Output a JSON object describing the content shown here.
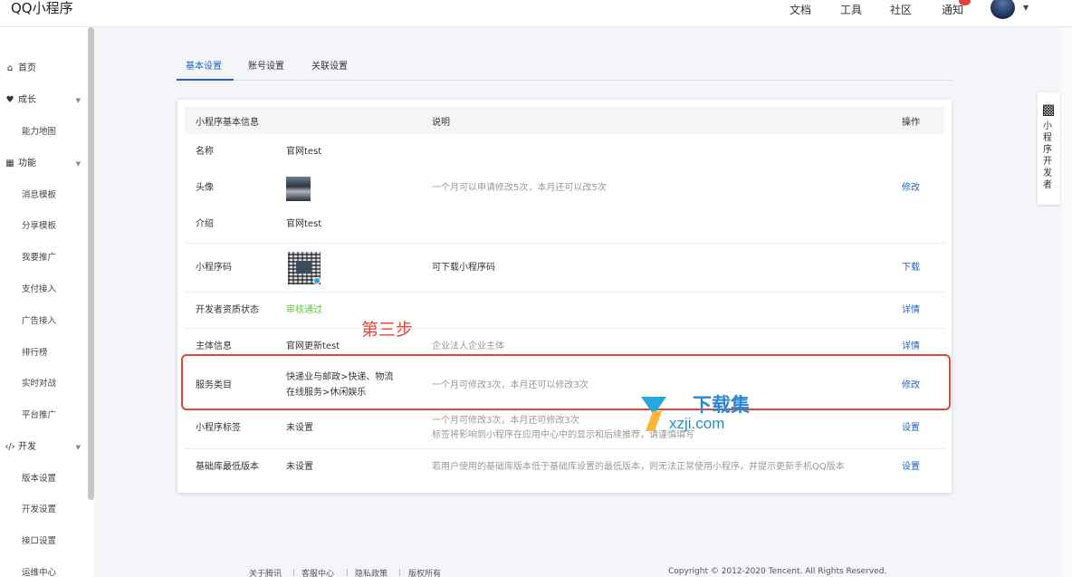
{
  "app": {
    "title": "QQ小程序"
  },
  "topnav": [
    "文档",
    "工具",
    "社区",
    "通知"
  ],
  "sidebar": {
    "items": [
      {
        "label": "首页",
        "icon": "home-icon",
        "glyph": "⌂",
        "type": "group"
      },
      {
        "label": "成长",
        "icon": "growth-icon",
        "glyph": "♥",
        "type": "group",
        "expandable": true
      },
      {
        "label": "能力地图",
        "type": "sub"
      },
      {
        "label": "功能",
        "icon": "function-icon",
        "glyph": "▦",
        "type": "group",
        "expandable": true
      },
      {
        "label": "消息模板",
        "type": "sub"
      },
      {
        "label": "分享模板",
        "type": "sub"
      },
      {
        "label": "我要推广",
        "type": "sub"
      },
      {
        "label": "支付接入",
        "type": "sub"
      },
      {
        "label": "广告接入",
        "type": "sub"
      },
      {
        "label": "排行榜",
        "type": "sub"
      },
      {
        "label": "实时对战",
        "type": "sub"
      },
      {
        "label": "平台推广",
        "type": "sub"
      },
      {
        "label": "开发",
        "icon": "code-icon",
        "glyph": "‹/›",
        "type": "group",
        "expandable": true
      },
      {
        "label": "版本设置",
        "type": "sub"
      },
      {
        "label": "开发设置",
        "type": "sub"
      },
      {
        "label": "接口设置",
        "type": "sub"
      },
      {
        "label": "运维中心",
        "type": "sub"
      }
    ]
  },
  "tabs": [
    "基本设置",
    "账号设置",
    "关联设置"
  ],
  "table": {
    "headers": {
      "info": "小程序基本信息",
      "desc": "说明",
      "action": "操作"
    },
    "rows": {
      "name": {
        "label": "名称",
        "value": "官网test"
      },
      "avatar": {
        "label": "头像",
        "desc": "一个月可以申请修改5次，本月还可以改5次",
        "action": "修改"
      },
      "intro": {
        "label": "介绍",
        "value": "官网test"
      },
      "qrcode": {
        "label": "小程序码",
        "desc": "可下载小程序码",
        "action": "下载"
      },
      "qualification": {
        "label": "开发者资质状态",
        "value": "审核通过",
        "action": "详情"
      },
      "subject": {
        "label": "主体信息",
        "value": "官网更新test",
        "desc": "企业法人企业主体",
        "action": "详情"
      },
      "category": {
        "label": "服务类目",
        "value_line1": "快递业与邮政>快递、物流",
        "value_line2": "在线服务>休闲娱乐",
        "desc": "一个月可修改3次，本月还可以修改3次",
        "action": "修改"
      },
      "tags": {
        "label": "小程序标签",
        "value": "未设置",
        "desc_line1": "一个月可修改3次，本月还可修改3次",
        "desc_line2": "标签将影响到小程序在应用中心中的显示和后续推荐，请谨慎填写",
        "action": "设置"
      },
      "base_lib": {
        "label": "基础库最低版本",
        "value": "未设置",
        "desc": "若用户使用的基础库版本低于基础库设置的最低版本，则无法正常使用小程序，并提示更新手机QQ版本",
        "action": "设置"
      }
    }
  },
  "annotation": {
    "step": "第三步"
  },
  "watermark": {
    "cn": "下载集",
    "en": "xzji.com"
  },
  "float_panel": {
    "label": "小程序开发者"
  },
  "footer": {
    "links": [
      "关于腾讯",
      "客服中心",
      "隐私政策",
      "版权所有"
    ],
    "copyright": "Copyright © 2012-2020 Tencent. All Rights Reserved."
  },
  "colors": {
    "accent": "#1e63c9",
    "success": "#67c23a",
    "annotation": "#e0463a"
  }
}
